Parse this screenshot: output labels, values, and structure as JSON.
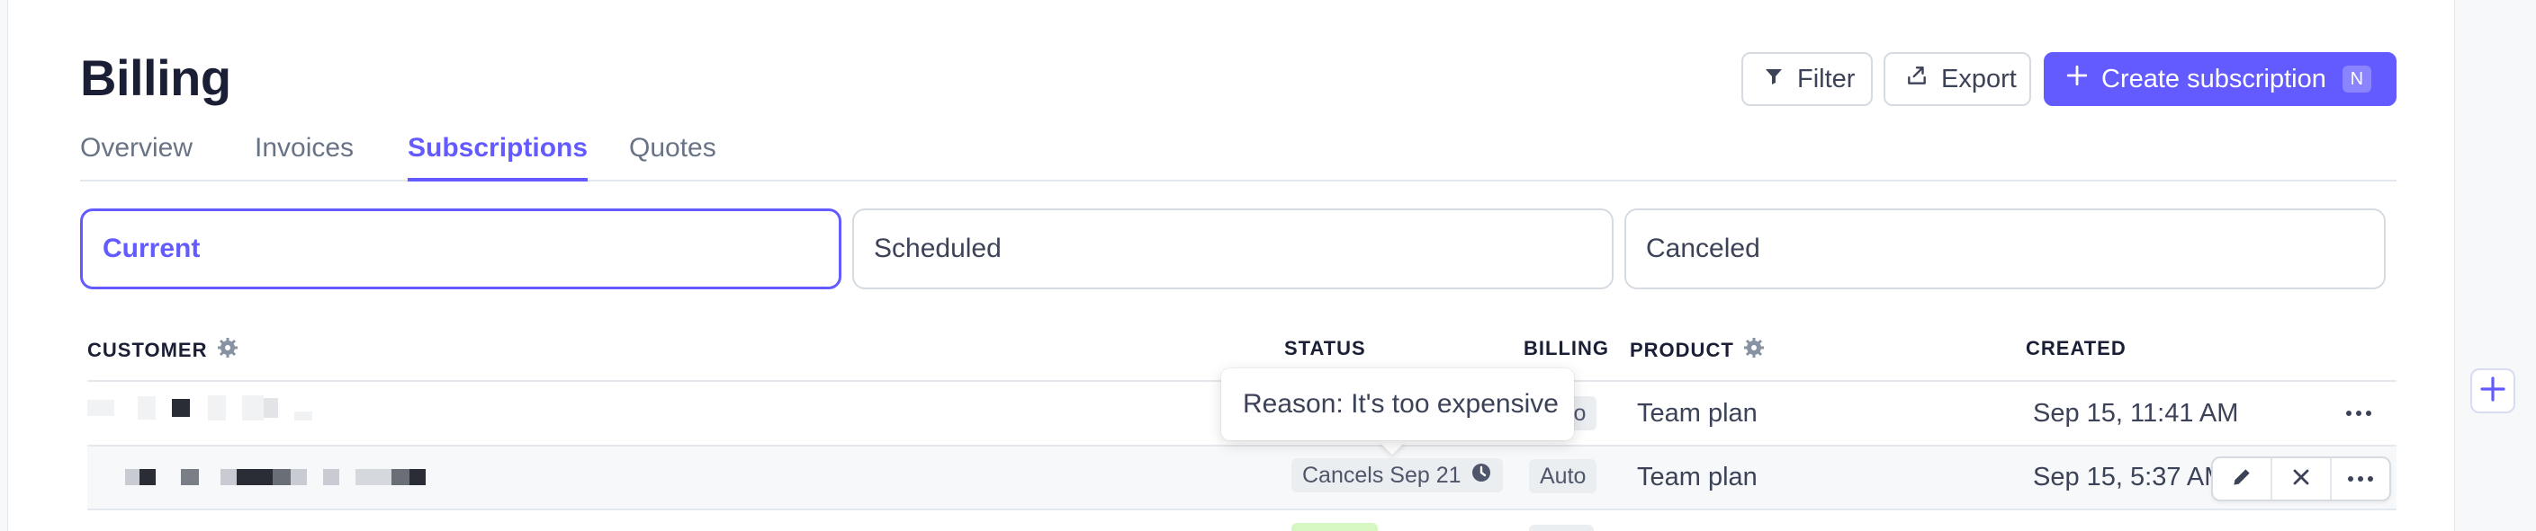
{
  "page": {
    "title": "Billing"
  },
  "toolbar": {
    "filter_label": "Filter",
    "export_label": "Export",
    "create_label": "Create subscription",
    "create_shortcut": "N"
  },
  "tabs": [
    {
      "label": "Overview",
      "active": false
    },
    {
      "label": "Invoices",
      "active": false
    },
    {
      "label": "Subscriptions",
      "active": true
    },
    {
      "label": "Quotes",
      "active": false
    }
  ],
  "segments": [
    {
      "label": "Current",
      "active": true
    },
    {
      "label": "Scheduled",
      "active": false
    },
    {
      "label": "Canceled",
      "active": false
    }
  ],
  "table": {
    "headers": {
      "customer": "CUSTOMER",
      "status": "STATUS",
      "billing": "BILLING",
      "product": "PRODUCT",
      "created": "CREATED"
    },
    "rows": [
      {
        "customer": "",
        "status": "",
        "billing": "Auto",
        "product": "Team plan",
        "created": "Sep 15, 11:41 AM"
      },
      {
        "customer": "",
        "status": "Cancels Sep 21",
        "billing": "Auto",
        "product": "Team plan",
        "created": "Sep 15, 5:37 AM"
      }
    ]
  },
  "tooltip": {
    "text": "Reason: It's too expensive"
  },
  "icons": {
    "filter": "filter-icon",
    "export": "export-icon",
    "create": "plus-icon",
    "settings": "gear-icon",
    "clock": "clock-icon",
    "edit": "pencil-icon",
    "cancel": "close-icon",
    "more": "more-horizontal-icon"
  },
  "colors": {
    "accent": "#635bff",
    "text": "#1a1f36",
    "muted": "#697386"
  }
}
